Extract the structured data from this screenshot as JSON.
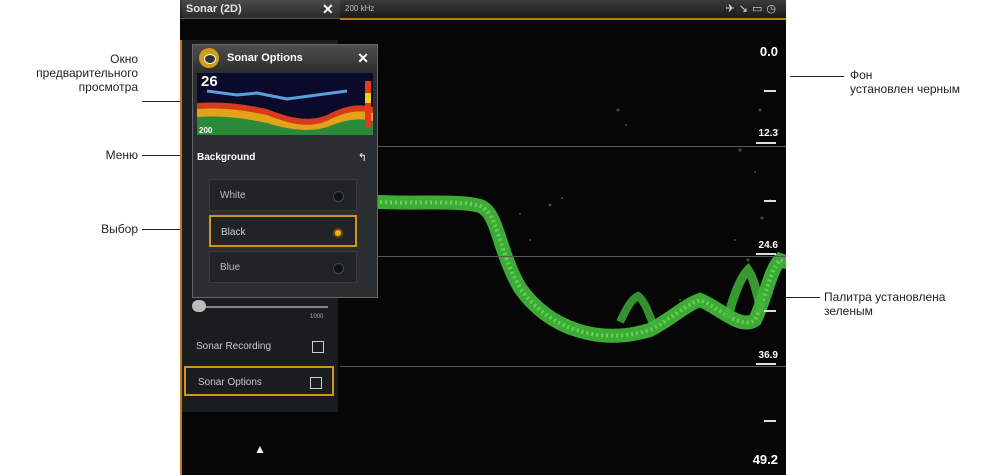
{
  "titlebar": {
    "tab_title": "Sonar (2D)",
    "frequency": "200 kHz"
  },
  "depth_scale": [
    "0.0",
    "12.3",
    "24.6",
    "36.9",
    "49.2"
  ],
  "side_menu": {
    "items": [
      {
        "label": "Sonar Recording"
      },
      {
        "label": "Sonar Options"
      }
    ],
    "slider_value": "1000"
  },
  "popup": {
    "title": "Sonar Options",
    "preview_depth_top": "26",
    "preview_depth_bottom": "200",
    "menu_label": "Background",
    "options": [
      {
        "label": "White",
        "selected": false
      },
      {
        "label": "Black",
        "selected": true
      },
      {
        "label": "Blue",
        "selected": false
      }
    ]
  },
  "annotations": {
    "preview_window": "Окно\nпредварительного\nпросмотра",
    "menu": "Меню",
    "selection": "Выбор",
    "background": "Фон\nустановлен черным",
    "palette": "Палитра установлена\nзеленым"
  },
  "colors": {
    "accent": "#d4921f",
    "sonar_green": "#3fb53a",
    "background": "#050605"
  }
}
